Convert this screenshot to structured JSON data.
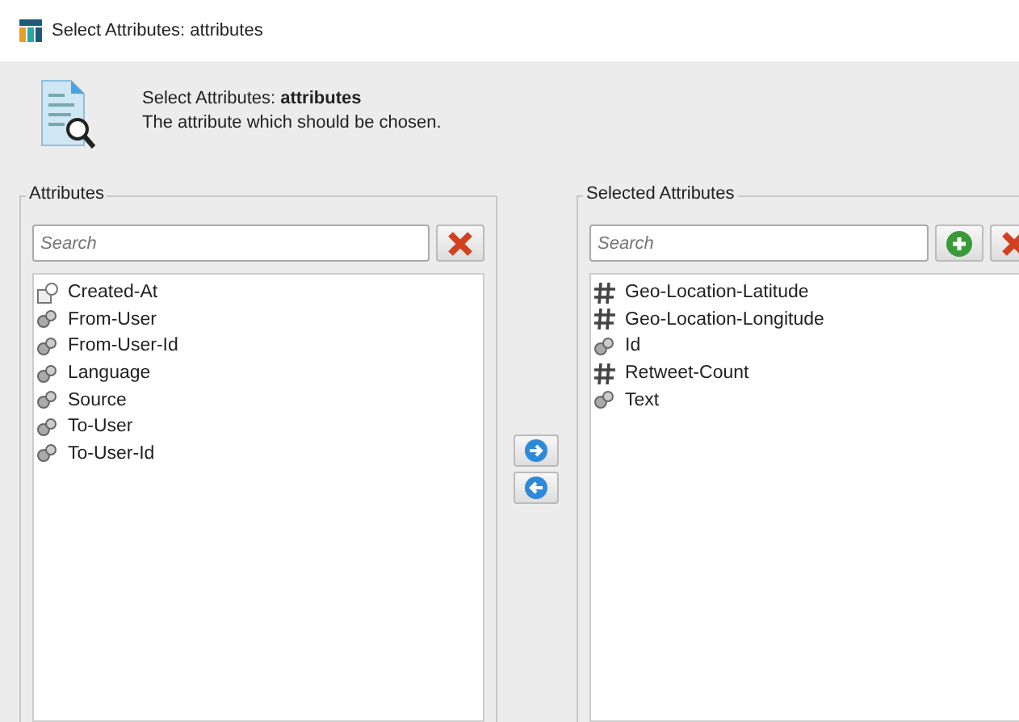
{
  "window": {
    "title": "Select Attributes: attributes"
  },
  "header": {
    "title": "Select Attributes: **attributes**",
    "description": "The attribute which should be chosen."
  },
  "available": {
    "label": "Attributes",
    "search": {
      "placeholder": "Search"
    },
    "items": [
      {
        "label": "Created-At",
        "kind": "date"
      },
      {
        "label": "From-User",
        "kind": "nominal"
      },
      {
        "label": "From-User-Id",
        "kind": "nominal"
      },
      {
        "label": "Language",
        "kind": "nominal"
      },
      {
        "label": "Source",
        "kind": "nominal"
      },
      {
        "label": "To-User",
        "kind": "nominal"
      },
      {
        "label": "To-User-Id",
        "kind": "nominal"
      }
    ]
  },
  "selected": {
    "label": "Selected Attributes",
    "search": {
      "placeholder": "Search"
    },
    "items": [
      {
        "label": "Geo-Location-Latitude",
        "kind": "numeric"
      },
      {
        "label": "Geo-Location-Longitude",
        "kind": "numeric"
      },
      {
        "label": "Id",
        "kind": "nominal"
      },
      {
        "label": "Retweet-Count",
        "kind": "numeric"
      },
      {
        "label": "Text",
        "kind": "nominal"
      }
    ]
  }
}
